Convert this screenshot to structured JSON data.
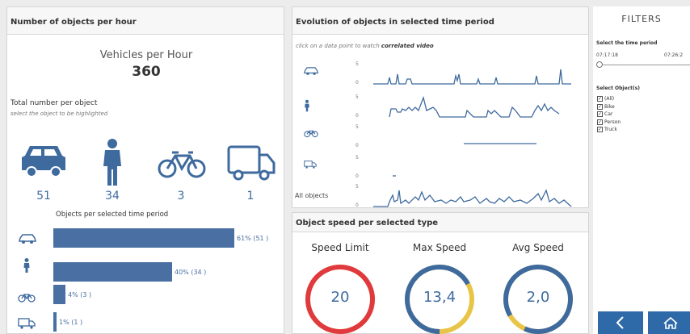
{
  "left_panel": {
    "header": "Number of objects per hour",
    "vph_title": "Vehicles per Hour",
    "vph_value": "360",
    "total_title": "Total number per object",
    "total_subtitle": "select the object to be highlighted",
    "counts": [
      {
        "icon": "car-icon",
        "value": "51"
      },
      {
        "icon": "person-icon",
        "value": "34"
      },
      {
        "icon": "bike-icon",
        "value": "3"
      },
      {
        "icon": "truck-icon",
        "value": "1"
      }
    ],
    "bars_title": "Objects per selected time period",
    "bars": [
      {
        "icon": "car-icon",
        "label": "61% (51 )",
        "fraction": 0.61
      },
      {
        "icon": "person-icon",
        "label": "40% (34 )",
        "fraction": 0.4
      },
      {
        "icon": "bike-icon",
        "label": "4% (3 )",
        "fraction": 0.04
      },
      {
        "icon": "truck-icon",
        "label": "1% (1 )",
        "fraction": 0.01
      }
    ]
  },
  "evolution_panel": {
    "header": "Evolution of objects in selected time period",
    "hint_prefix": "click on a data point to watch ",
    "hint_emph": "correlated video",
    "lanes": [
      {
        "icon": "car-icon",
        "label": "",
        "ytop": "5",
        "ybottom": "0"
      },
      {
        "icon": "person-icon",
        "label": "",
        "ytop": "5",
        "ybottom": "0"
      },
      {
        "icon": "bike-icon",
        "label": "",
        "ytop": "5",
        "ybottom": "0"
      },
      {
        "icon": "truck-icon",
        "label": "",
        "ytop": "5",
        "ybottom": "0"
      },
      {
        "icon": "",
        "label": "All objects",
        "ytop": "5",
        "ybottom": "0"
      }
    ]
  },
  "speed_panel": {
    "header": "Object speed per selected type",
    "gauges": [
      {
        "title": "Speed Limit",
        "value": "20",
        "fill": 1.0,
        "color": "#e0393e"
      },
      {
        "title": "Max Speed",
        "value": "13,4",
        "fill": 0.67,
        "color": "#3e6a9e"
      },
      {
        "title": "Avg Speed",
        "value": "2,0",
        "fill": 0.9,
        "color": "#3e6a9e"
      }
    ],
    "gauge_track_color": "#e8c547"
  },
  "filters": {
    "title": "FILTERS",
    "time_label": "Select the time period",
    "time_start": "07:17:18",
    "time_end": "07:26:2",
    "objects_label": "Select Object(s)",
    "objects": [
      "(All)",
      "Bike",
      "Car",
      "Person",
      "Truck"
    ],
    "nav_back_icon": "chevron-left-icon",
    "nav_home_icon": "home-icon",
    "nav_color": "#2e6aa8"
  }
}
